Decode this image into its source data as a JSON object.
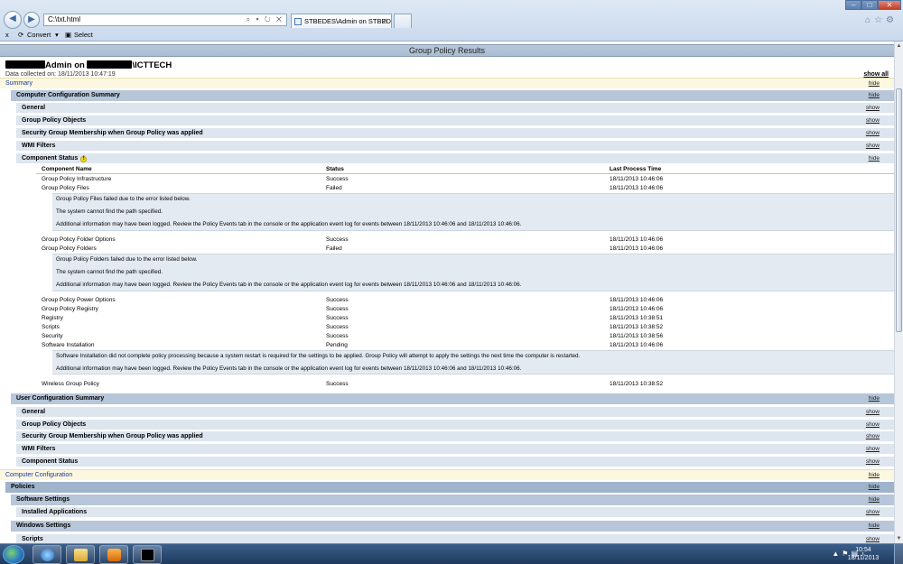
{
  "browser": {
    "address": "C:\\txt.html",
    "active_tab": "STBEDES\\Admin on STBED...",
    "tab_close": "✕",
    "commands": {
      "convert": "Convert",
      "select": "Select",
      "close_x": "x"
    }
  },
  "report": {
    "title": "Group Policy Results",
    "user_admin": "Admin on ",
    "user_domain": "\\ICTTECH",
    "data_collected": "Data collected on: 18/11/2013 10:47:19",
    "show_all": "show all",
    "hide": "hide",
    "show": "show",
    "summary": "Summary",
    "computer_summary": {
      "title": "Computer Configuration Summary",
      "general": "General",
      "gpo": "Group Policy Objects",
      "security_group": "Security Group Membership when Group Policy was applied",
      "wmi": "WMI Filters",
      "component_status": "Component Status",
      "warn": "!"
    },
    "table": {
      "headers": [
        "Component Name",
        "Status",
        "Last Process Time"
      ],
      "rows": [
        [
          "Group Policy Infrastructure",
          "Success",
          "18/11/2013 10:46:06"
        ],
        [
          "Group Policy Files",
          "Failed",
          "18/11/2013 10:46:06"
        ],
        [
          "Group Policy Folder Options",
          "Success",
          "18/11/2013 10:46:06"
        ],
        [
          "Group Policy Folders",
          "Failed",
          "18/11/2013 10:46:06"
        ],
        [
          "Group Policy Power Options",
          "Success",
          "18/11/2013 10:46:06"
        ],
        [
          "Group Policy Registry",
          "Success",
          "18/11/2013 10:46:06"
        ],
        [
          "Registry",
          "Success",
          "18/11/2013 10:38:51"
        ],
        [
          "Scripts",
          "Success",
          "18/11/2013 10:38:52"
        ],
        [
          "Security",
          "Success",
          "18/11/2013 10:38:56"
        ],
        [
          "Software Installation",
          "Pending",
          "18/11/2013 10:46:06"
        ],
        [
          "Wireless Group Policy",
          "Success",
          "18/11/2013 10:38:52"
        ]
      ],
      "files_detail": [
        "Group Policy Files failed due to the error listed below.",
        "The system cannot find the path specified.",
        "Additional information may have been logged. Review the Policy Events tab in the console or the application event log for events between 18/11/2013 10:46:06 and 18/11/2013 10:46:06."
      ],
      "folders_detail": [
        "Group Policy Folders failed due to the error listed below.",
        "The system cannot find the path specified.",
        "Additional information may have been logged. Review the Policy Events tab in the console or the application event log for events between 18/11/2013 10:46:06 and 18/11/2013 10:46:06."
      ],
      "software_detail": [
        "Software Installation did not complete policy processing because a system restart is required for the settings to be applied. Group Policy will attempt to apply the settings the next time the computer is restarted.",
        "Additional information may have been logged. Review the Policy Events tab in the console or the application event log for events between 18/11/2013 10:46:06 and 18/11/2013 10:46:06."
      ]
    },
    "user_summary": {
      "title": "User Configuration Summary",
      "general": "General",
      "gpo": "Group Policy Objects",
      "security_group": "Security Group Membership when Group Policy was applied",
      "wmi": "WMI Filters",
      "component_status": "Component Status"
    },
    "computer_configuration": "Computer Configuration",
    "policies": "Policies",
    "software_settings": "Software Settings",
    "installed_applications": "Installed Applications",
    "windows_settings": "Windows Settings",
    "scripts": "Scripts"
  },
  "taskbar": {
    "time": "10:54",
    "date": "18/11/2013"
  },
  "colors": {
    "summary_bar": "#fbf7e0",
    "summary_text": "#1b3a9b",
    "section_l1": "#b7c6d9",
    "section_l2": "#dde5ef",
    "detail_bg": "#e4eaf1"
  }
}
